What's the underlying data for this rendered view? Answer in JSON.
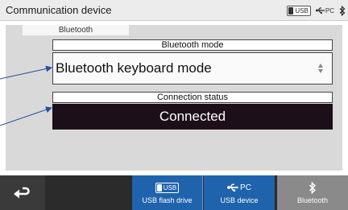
{
  "titlebar": {
    "title": "Communication device",
    "usb_chip_label": "USB",
    "pc_label": "PC",
    "icons": [
      "usb-chip-icon",
      "usb-plug-icon",
      "bluetooth-icon"
    ]
  },
  "panel": {
    "tab_label": "Bluetooth",
    "mode_label": "Bluetooth mode",
    "mode_value": "Bluetooth keyboard mode",
    "connection_label": "Connection status",
    "connection_value": "Connected"
  },
  "bottombar": {
    "back_icon": "return-arrow-icon",
    "buttons": [
      {
        "top": "USB",
        "label": "USB flash drive",
        "icon": "usb-chip-icon",
        "color": "#1f63ad"
      },
      {
        "top": "PC",
        "label": "USB device",
        "icon": "usb-plug-icon",
        "color": "#1f63ad"
      },
      {
        "label": "Bluetooth",
        "icon": "bluetooth-icon",
        "color": "#8a8a8a"
      }
    ]
  },
  "colors": {
    "accent": "#1f63ad",
    "connected_bg": "#1c0f1a",
    "callout_arrow": "#2450a0"
  }
}
